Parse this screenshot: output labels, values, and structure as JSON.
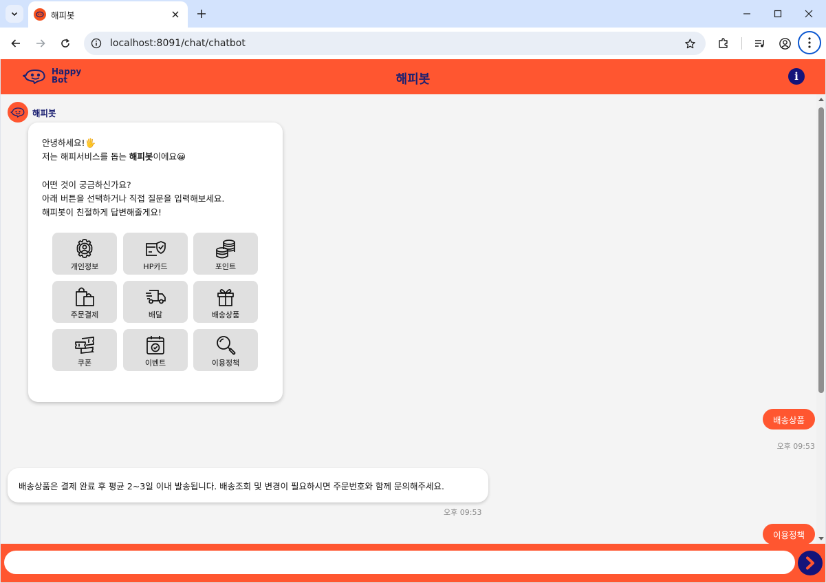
{
  "browser": {
    "tab_title": "해피봇",
    "url": "localhost:8091/chat/chatbot"
  },
  "header": {
    "logo_line1": "Happy",
    "logo_line2": "Bot",
    "title": "해피봇",
    "info_glyph": "i"
  },
  "bot": {
    "name": "해피봇"
  },
  "welcome": {
    "line1": "안녕하세요!",
    "line1_emoji": "🖐",
    "line2_pre": "저는 해피서비스를 돕는 ",
    "line2_bold": "해피봇",
    "line2_post": "이에요",
    "line2_emoji": "😀",
    "line3": "어떤 것이 궁금하신가요?",
    "line4": "아래 버튼을 선택하거나 직접 질문을 입력해보세요.",
    "line5": "해피봇이 친절하게 답변해줄게요!"
  },
  "menu": [
    {
      "label": "개인정보",
      "icon": "user-gear-icon"
    },
    {
      "label": "HP카드",
      "icon": "card-shield-icon"
    },
    {
      "label": "포인트",
      "icon": "coins-icon"
    },
    {
      "label": "주문결제",
      "icon": "shopping-bags-icon"
    },
    {
      "label": "배달",
      "icon": "truck-icon"
    },
    {
      "label": "배송상품",
      "icon": "gift-icon"
    },
    {
      "label": "쿠폰",
      "icon": "coupon-icon"
    },
    {
      "label": "이벤트",
      "icon": "calendar-check-icon"
    },
    {
      "label": "이용정책",
      "icon": "magnifier-icon"
    }
  ],
  "messages": {
    "user1": "배송상품",
    "user1_time": "오후 09:53",
    "bot1": "배송상품은 결제 완료 후 평균 2~3일 이내 발송됩니다. 배송조회 및 변경이 필요하시면 주문번호와 함께 문의해주세요.",
    "bot1_time": "오후 09:53",
    "user2": "이용정책"
  },
  "input": {
    "placeholder": ""
  },
  "colors": {
    "accent": "#ff5630",
    "navy": "#1a1f71",
    "chat_bg": "#f4f4f4"
  }
}
